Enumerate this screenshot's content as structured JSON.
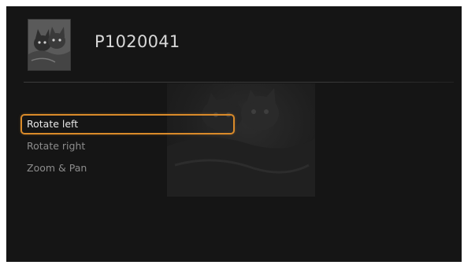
{
  "header": {
    "thumbnail_icon": "photo-thumbnail",
    "title": "P1020041"
  },
  "photo": {
    "icon": "cat-photo-background"
  },
  "menu": {
    "items": [
      {
        "label": "Rotate left",
        "selected": true
      },
      {
        "label": "Rotate right",
        "selected": false
      },
      {
        "label": "Zoom & Pan",
        "selected": false
      }
    ]
  },
  "colors": {
    "background": "#151515",
    "selection_border": "#d98a2a",
    "title_text": "#d8d8d8",
    "menu_text": "#8c8c8c"
  }
}
